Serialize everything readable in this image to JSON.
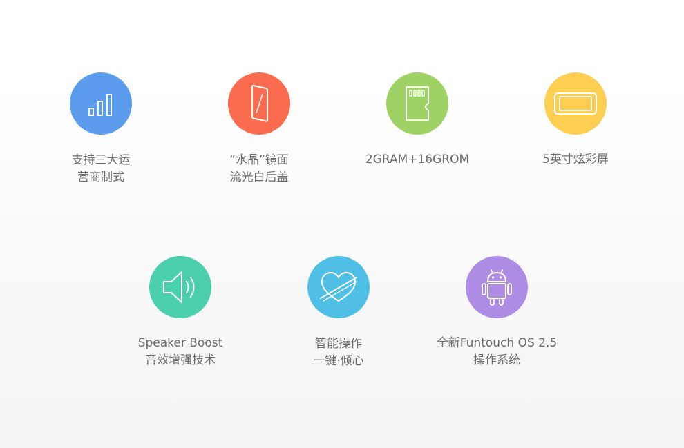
{
  "features_row1": [
    {
      "color": "#5b9cec",
      "icon": "signal-bars-icon",
      "lines": [
        "支持三大运",
        "营商制式"
      ]
    },
    {
      "color": "#fb6c4f",
      "icon": "phone-glass-icon",
      "lines": [
        "“水晶”镜面",
        "流光白后盖"
      ]
    },
    {
      "color": "#9fd264",
      "icon": "sd-card-icon",
      "lines": [
        "2GRAM+16GROM"
      ]
    },
    {
      "color": "#fcce52",
      "icon": "screen-landscape-icon",
      "lines": [
        "5英寸炫彩屏"
      ]
    }
  ],
  "features_row2": [
    {
      "color": "#4ccfad",
      "icon": "speaker-icon",
      "lines": [
        "Speaker Boost",
        "音效增强技术"
      ]
    },
    {
      "color": "#4fbfe6",
      "icon": "heart-crossed-icon",
      "lines": [
        "智能操作",
        "一键·倾心"
      ]
    },
    {
      "color": "#ae8ce5",
      "icon": "android-robot-icon",
      "lines": [
        "全新Funtouch OS 2.5",
        "操作系统"
      ]
    }
  ]
}
